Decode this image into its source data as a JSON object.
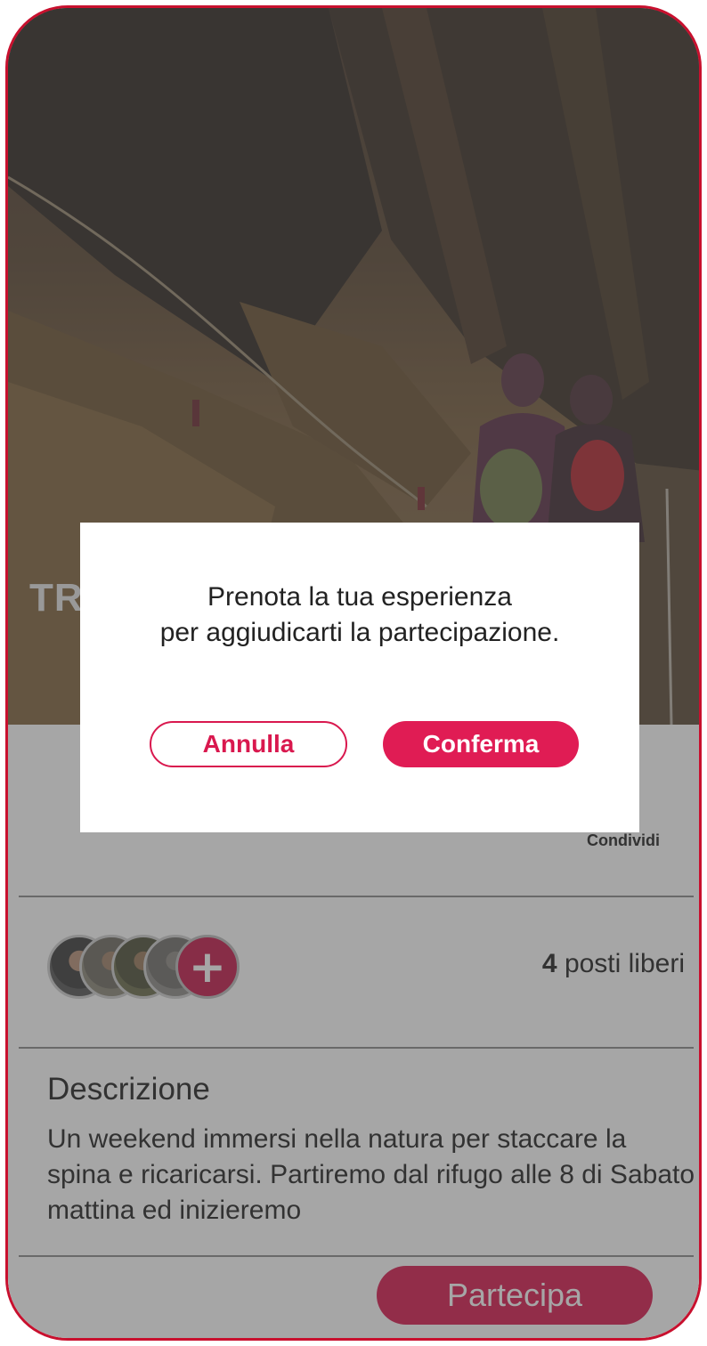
{
  "hero": {
    "title_fragment": "TR"
  },
  "event": {
    "share_label": "Condividi",
    "seats_count": "4",
    "seats_label": "posti liberi",
    "participants_icon": "plus-icon",
    "description_title": "Descrizione",
    "description_text": "Un weekend immersi nella natura per staccare la spina e ricaricarsi. Partiremo dal rifugo alle 8 di Sabato mattina ed inizieremo",
    "join_button": "Partecipa"
  },
  "modal": {
    "line1": "Prenota la tua esperienza",
    "line2": "per aggiudicarti la partecipazione.",
    "cancel_button": "Annulla",
    "confirm_button": "Conferma"
  },
  "colors": {
    "accent": "#d9184e",
    "frame": "#c8102e",
    "overlay": "rgba(70,70,70,0.48)"
  }
}
